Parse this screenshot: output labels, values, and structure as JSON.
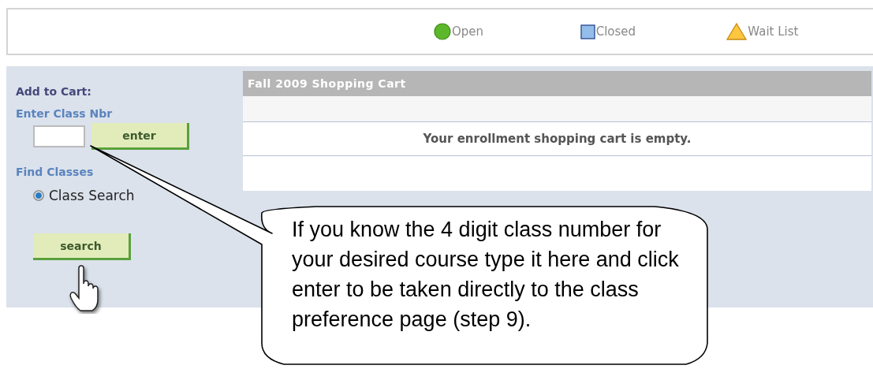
{
  "legend": [
    {
      "kind": "circle",
      "label": "Open"
    },
    {
      "kind": "square",
      "label": "Closed"
    },
    {
      "kind": "triangle",
      "label": "Wait List"
    }
  ],
  "add_to_cart": {
    "title": "Add to Cart:",
    "field_label": "Enter Class Nbr",
    "enter_button": "enter"
  },
  "find_classes": {
    "title": "Find Classes",
    "options": [
      {
        "label": "Class Search",
        "selected": true
      }
    ],
    "search_button": "search"
  },
  "cart": {
    "title": "Fall 2009 Shopping Cart",
    "message": "Your enrollment shopping cart is empty."
  },
  "callout": {
    "text": "If you know the 4 digit class number for your desired course type it here and click enter to be taken directly to the class preference page (step 9)."
  }
}
